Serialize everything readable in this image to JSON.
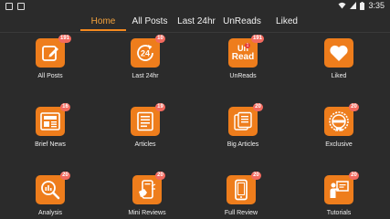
{
  "status_bar": {
    "time": "3:35"
  },
  "tabs": [
    {
      "label": "Home",
      "active": true
    },
    {
      "label": "All Posts"
    },
    {
      "label": "Last 24hr"
    },
    {
      "label": "UnReads"
    },
    {
      "label": "Liked"
    }
  ],
  "tiles": [
    {
      "label": "All Posts",
      "badge": "191",
      "icon": "edit-note-icon"
    },
    {
      "label": "Last 24hr",
      "badge": "10",
      "icon": "24-hours-icon"
    },
    {
      "label": "UnReads",
      "badge": "191",
      "icon": "unread-icon",
      "icon_text_top": "Un",
      "icon_text_bottom": "Read",
      "icon_count": "1"
    },
    {
      "label": "Liked",
      "badge": "",
      "icon": "heart-icon"
    },
    {
      "label": "Brief News",
      "badge": "16",
      "icon": "newspaper-icon",
      "icon_text": "NEWS"
    },
    {
      "label": "Articles",
      "badge": "19",
      "icon": "article-icon"
    },
    {
      "label": "Big Articles",
      "badge": "20",
      "icon": "big-article-icon"
    },
    {
      "label": "Exclusive",
      "badge": "20",
      "icon": "exclusive-seal-icon"
    },
    {
      "label": "Analysis",
      "badge": "20",
      "icon": "magnifier-chart-icon"
    },
    {
      "label": "Mini Reviews",
      "badge": "20",
      "icon": "phone-review-icon"
    },
    {
      "label": "Full Review",
      "badge": "20",
      "icon": "smartphone-icon"
    },
    {
      "label": "Tutorials",
      "badge": "20",
      "icon": "teacher-board-icon"
    }
  ],
  "colors": {
    "accent": "#f48a1f",
    "tile": "#ee7d1c",
    "badge": "#f26a5f",
    "background": "#2b2b2b"
  }
}
